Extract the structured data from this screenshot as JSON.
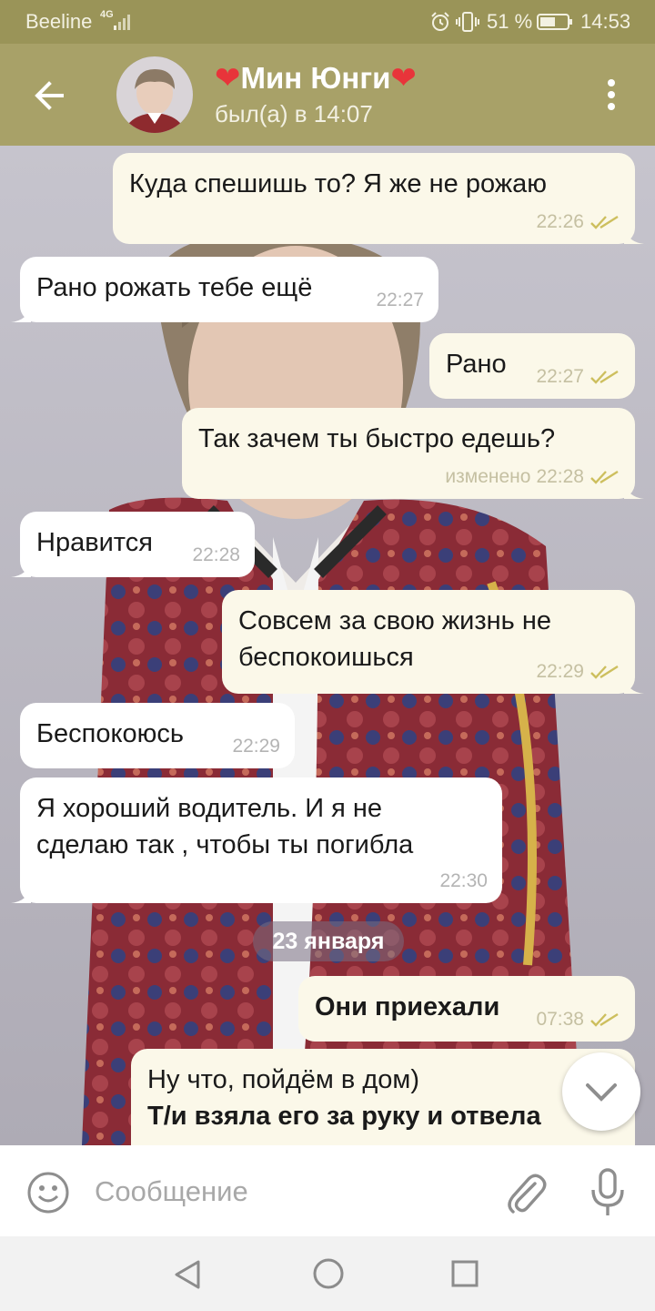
{
  "status_bar": {
    "carrier": "Beeline",
    "network": "4G",
    "battery_percent": "51 %",
    "time": "14:53"
  },
  "header": {
    "heart_left": "❤",
    "contact_name": "Мин Юнги",
    "heart_right": "❤",
    "last_seen": "был(а) в 14:07",
    "icons": [
      "back-arrow-icon",
      "avatar",
      "more-vertical-icon"
    ]
  },
  "messages": [
    {
      "direction": "out",
      "text": "Куда спешишь то? Я же не рожаю",
      "time": "22:26",
      "status": "read"
    },
    {
      "direction": "in",
      "text": "Рано рожать тебе ещё",
      "time": "22:27"
    },
    {
      "direction": "out",
      "text": "Рано",
      "time": "22:27",
      "status": "read"
    },
    {
      "direction": "out",
      "text": "Так зачем ты быстро едешь?",
      "edited": "изменено",
      "time": "22:28",
      "status": "read"
    },
    {
      "direction": "in",
      "text": "Нравится",
      "time": "22:28"
    },
    {
      "direction": "out",
      "lines": [
        "Совсем за свою жизнь не",
        "беспокоишься"
      ],
      "time": "22:29",
      "status": "read"
    },
    {
      "direction": "in",
      "text": "Беспокоюсь",
      "time": "22:29"
    },
    {
      "direction": "in",
      "lines": [
        "Я хороший водитель. И я не",
        "сделаю так , чтобы ты погибла"
      ],
      "time": "22:30"
    },
    {
      "direction": "out",
      "text": "Они приехали",
      "time": "07:38",
      "status": "read",
      "bold": true
    },
    {
      "direction": "out",
      "lines": [
        "Ну что, пойдём в дом)",
        "Т/и взяла его за руку и отвела"
      ],
      "partial": true
    }
  ],
  "date_separator": "23 января",
  "input": {
    "placeholder": "Сообщение",
    "value": ""
  },
  "colors": {
    "header": "#a8a168",
    "status_bar": "#9a9458",
    "bubble_out": "#fbf8e9",
    "bubble_in": "#ffffff",
    "read_tick": "#cdbf5e",
    "heart": "#e8343a"
  }
}
